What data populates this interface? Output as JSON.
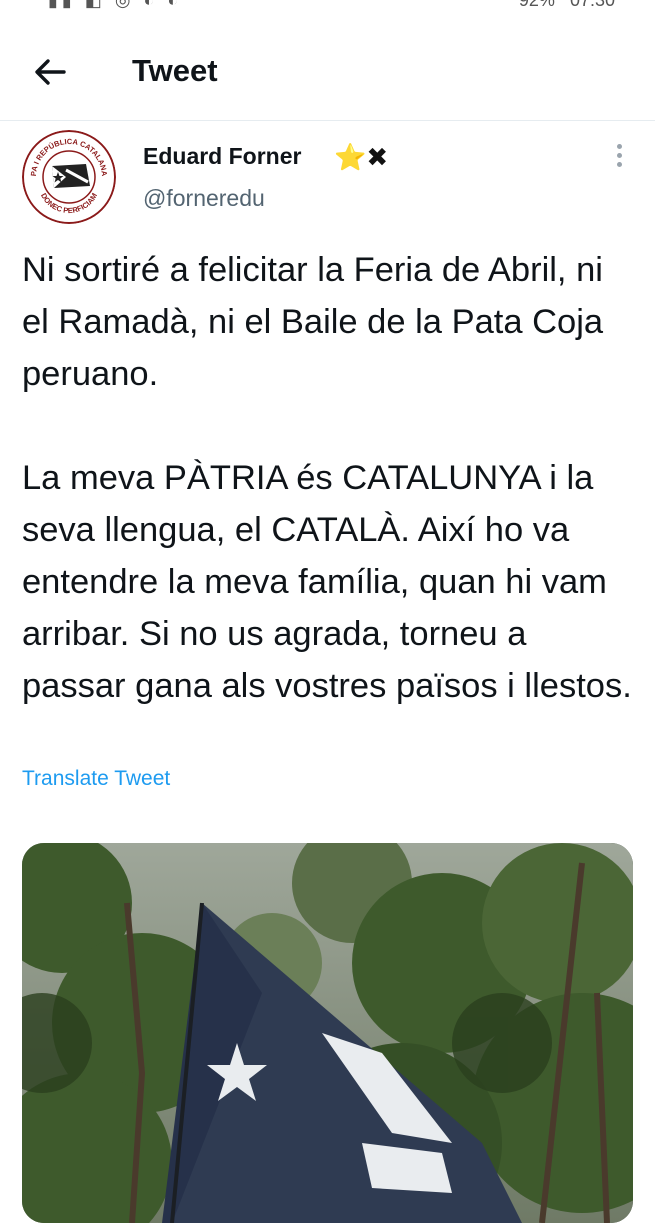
{
  "status_bar": {
    "left_icons": "▮▮ ◧ ◎ ◐ ◐",
    "battery_text": "92%",
    "time": "07:30"
  },
  "header": {
    "title": "Tweet",
    "back_icon": "arrow-left-icon"
  },
  "tweet": {
    "author": {
      "name": "Eduard Forner",
      "name_emoji_star": "⭐",
      "name_emoji_cross": "✖",
      "handle": "@forneredu",
      "avatar_text_top": "PA I REPÚBLICA CATALANA",
      "avatar_text_bottom": "DONEC PERFICIAM"
    },
    "paragraphs": [
      "Ni sortiré a felicitar la Feria de Abril, ni el Ramadà, ni el Baile de la Pata Coja peruano.",
      "La meva PÀTRIA és CATALUNYA i la seva llengua, el CATALÀ. Així ho va entendre la meva família, quan hi vam arribar.  Si no us agrada, torneu a passar gana als vostres països i llestos."
    ],
    "translate_label": "Translate Tweet",
    "media": {
      "description_icon": "flag-photo",
      "colors": {
        "flag_blue": "#2f3b52",
        "flag_white": "#e9ecef",
        "foliage": "#3e5a2c"
      }
    }
  },
  "colors": {
    "accent": "#1d9bf0",
    "text_primary": "#0f1419",
    "text_secondary": "#536471"
  }
}
